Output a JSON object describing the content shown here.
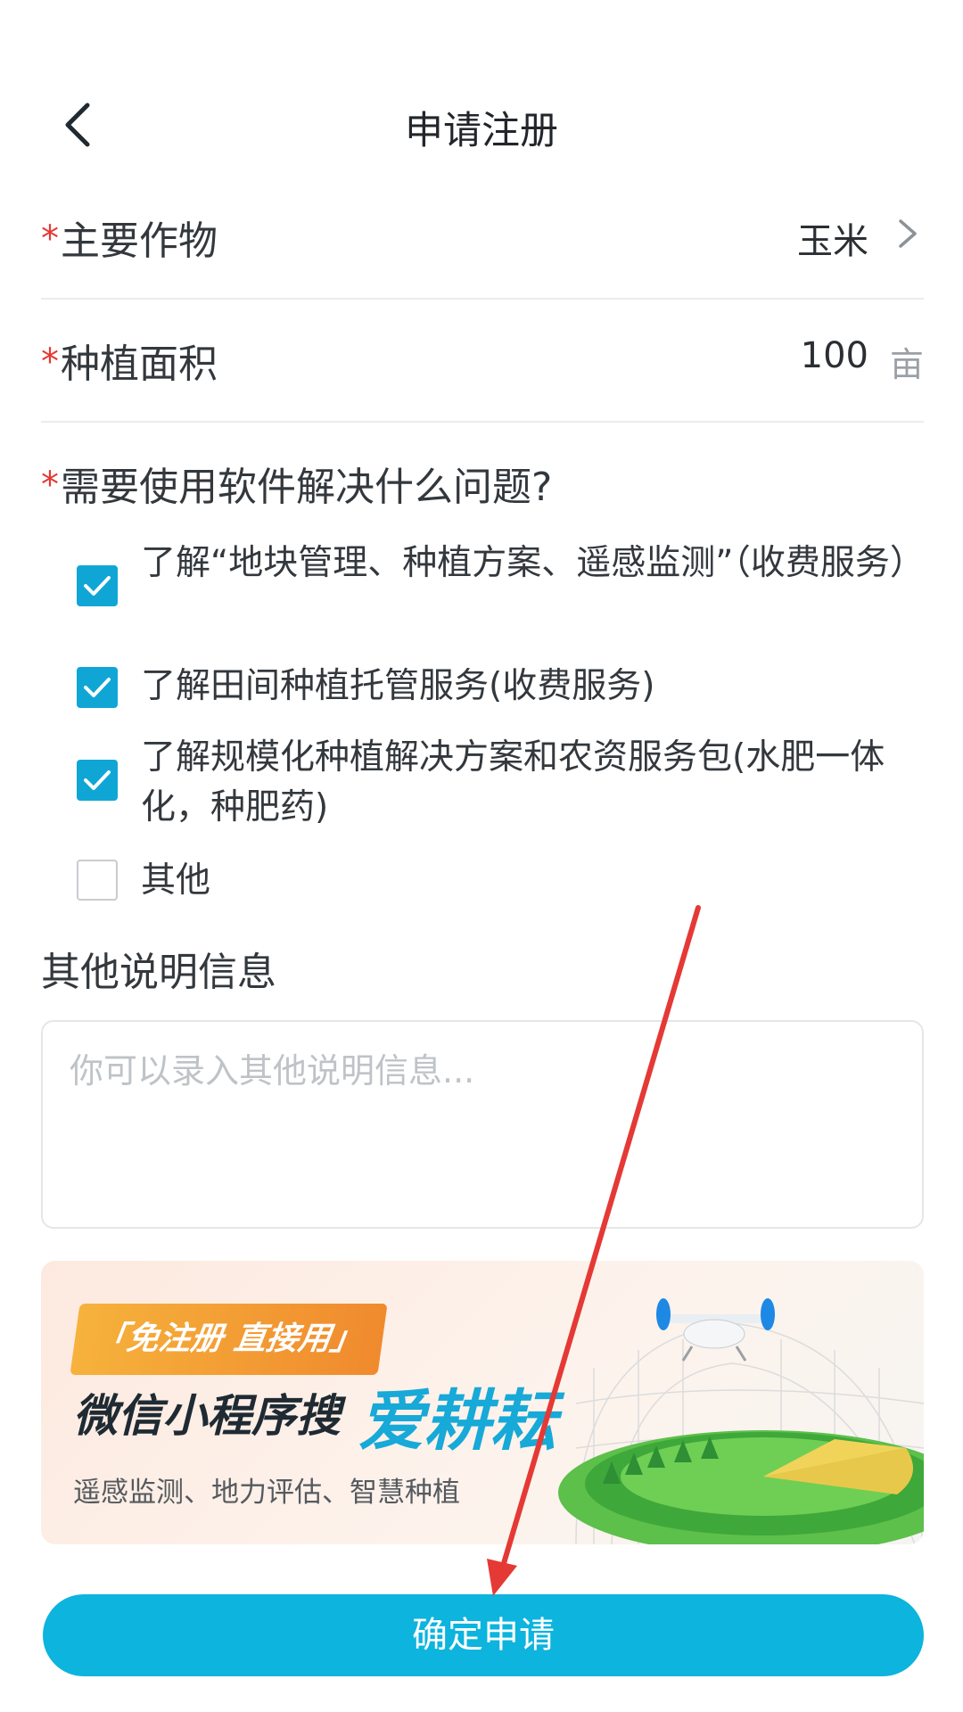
{
  "header": {
    "title": "申请注册"
  },
  "form": {
    "crop": {
      "required_mark": "*",
      "label": "主要作物",
      "value": "玉米"
    },
    "area": {
      "required_mark": "*",
      "label": "种植面积",
      "value": "100",
      "unit": "亩"
    },
    "question": {
      "required_mark": "*",
      "label": "需要使用软件解决什么问题?"
    },
    "options": [
      {
        "text": "了解“地块管理、种植方案、遥感监测”（收费服务）",
        "checked": true
      },
      {
        "text": "了解田间种植托管服务(收费服务)",
        "checked": true
      },
      {
        "text": "了解规模化种植解决方案和农资服务包(水肥一体化，种肥药)",
        "checked": true
      },
      {
        "text": "其他",
        "checked": false
      }
    ],
    "notes": {
      "label": "其他说明信息",
      "placeholder": "你可以录入其他说明信息..."
    }
  },
  "banner": {
    "badge": "「免注册 直接用」",
    "main": "微信小程序搜",
    "brand": "爱耕耘",
    "sub": "遥感监测、地力评估、智慧种植"
  },
  "submit": {
    "label": "确定申请"
  },
  "colors": {
    "accent": "#0cb4de",
    "required": "#e53935",
    "checkbox": "#0fa6d6",
    "annotation_arrow": "#e53935"
  },
  "icons": {
    "back": "chevron-left-icon",
    "chevron": "chevron-right-icon",
    "check": "check-icon",
    "drone": "drone-icon"
  }
}
